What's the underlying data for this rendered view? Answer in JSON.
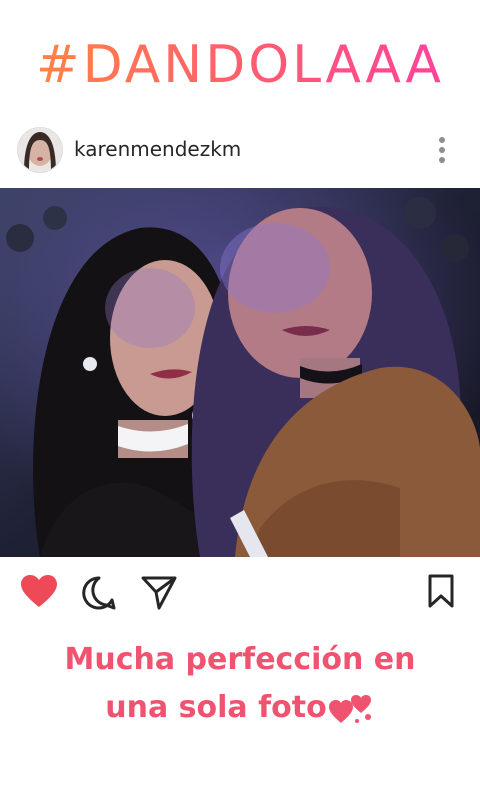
{
  "hashtag": "#DANDOLAAA",
  "post": {
    "username": "karenmendezkm",
    "caption_line1": "Mucha perfección en",
    "caption_line2": "una sola foto",
    "liked": true
  },
  "icons": {
    "more": "more-vertical-icon",
    "like": "heart-icon",
    "comment": "comment-icon",
    "share": "send-icon",
    "save": "bookmark-icon",
    "caption_emoji": "two-hearts-icon"
  },
  "colors": {
    "hashtag_gradient": [
      "#ff8a3d",
      "#ff5a73",
      "#ff3fa3"
    ],
    "like": "#ed4956",
    "caption": "#f0536f"
  }
}
